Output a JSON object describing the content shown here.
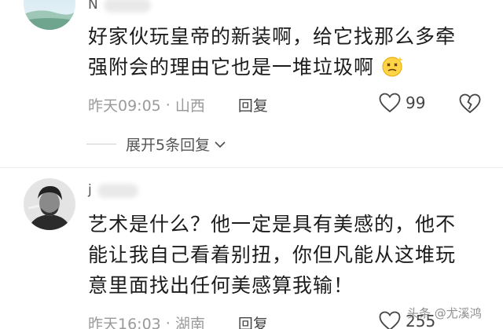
{
  "comments": [
    {
      "username": "N",
      "text_line1": "好家伙玩皇帝的新装啊，给它找那么多牵",
      "text_line2": "强附会的理由它也是一堆垃圾啊",
      "emoji_icon": "dizzy-face-emoji-icon",
      "time": "昨天09:05",
      "separator": "·",
      "location": "山西",
      "reply_label": "回复",
      "likes": "99"
    },
    {
      "username": "j",
      "text_line1": "艺术是什么？他一定是具有美感的，他不",
      "text_line2": "能让我自己看着别扭，你但凡能从这堆玩",
      "text_line3": "意里面找出任何美感算我输！",
      "time": "昨天16:03",
      "separator": "·",
      "location": "湖南",
      "reply_label": "回复",
      "likes": "255"
    }
  ],
  "expand_replies": "展开5条回复",
  "watermark": "头条 @尤溪鸿"
}
